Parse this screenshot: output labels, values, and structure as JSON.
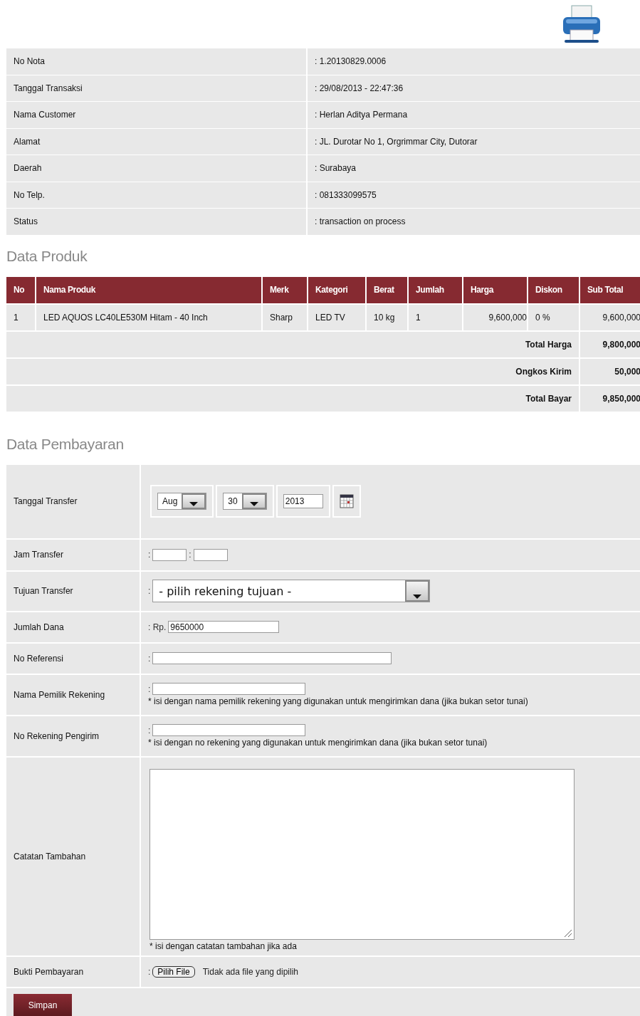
{
  "info_rows": [
    {
      "label": "No Nota",
      "value": ": 1.20130829.0006"
    },
    {
      "label": "Tanggal Transaksi",
      "value": ": 29/08/2013 - 22:47:36"
    },
    {
      "label": "Nama Customer",
      "value": ": Herlan Aditya Permana"
    },
    {
      "label": "Alamat",
      "value": ": JL. Durotar No 1, Orgrimmar City, Dutorar"
    },
    {
      "label": "Daerah",
      "value": ": Surabaya"
    },
    {
      "label": "No Telp.",
      "value": ": 081333099575"
    },
    {
      "label": "Status",
      "value": ": transaction on process"
    }
  ],
  "product_section": {
    "title": "Data Produk",
    "columns": [
      "No",
      "Nama Produk",
      "Merk",
      "Kategori",
      "Berat",
      "Jumlah",
      "Harga",
      "Diskon",
      "Sub Total"
    ],
    "rows": [
      [
        "1",
        "LED AQUOS LC40LE530M Hitam - 40 Inch",
        "Sharp",
        "LED TV",
        "10 kg",
        "1",
        "9,600,000",
        "0 %",
        "9,600,000"
      ]
    ],
    "totals": [
      {
        "label": "Total Harga",
        "value": "9,800,000"
      },
      {
        "label": "Ongkos Kirim",
        "value": "50,000"
      },
      {
        "label": "Total Bayar",
        "value": "9,850,000"
      }
    ]
  },
  "payment_section": {
    "title": "Data Pembayaran",
    "rows": [
      {
        "kind": "date",
        "label": "Tanggal Transfer",
        "month": "Aug",
        "day": "30",
        "year": "2013"
      },
      {
        "kind": "time",
        "label": "Jam Transfer",
        "separator": ":",
        "prefix": ":"
      },
      {
        "kind": "select",
        "label": "Tujuan Transfer",
        "prefix": ":",
        "value": "- pilih rekening tujuan -"
      },
      {
        "kind": "amount",
        "label": "Jumlah Dana",
        "prefix": ": Rp.",
        "value": "9650000"
      },
      {
        "kind": "text",
        "label": "No Referensi",
        "prefix": ":"
      },
      {
        "kind": "text_hint",
        "label": "Nama Pemilik Rekening",
        "prefix": ":",
        "hint": "* isi dengan nama pemilik rekening yang digunakan untuk mengirimkan dana (jika bukan setor tunai)"
      },
      {
        "kind": "text_hint",
        "label": "No Rekening Pengirim",
        "prefix": ":",
        "hint": "* isi dengan no rekening yang digunakan untuk mengirimkan dana (jika bukan setor tunai)"
      },
      {
        "kind": "textarea",
        "label": "Catatan Tambahan",
        "hint": "* isi dengan catatan tambahan jika ada"
      },
      {
        "kind": "file",
        "label": "Bukti Pembayaran",
        "prefix": ":",
        "button": "Pilih File",
        "status": "Tidak ada file yang dipilih"
      }
    ]
  },
  "submit_button": "Simpan"
}
